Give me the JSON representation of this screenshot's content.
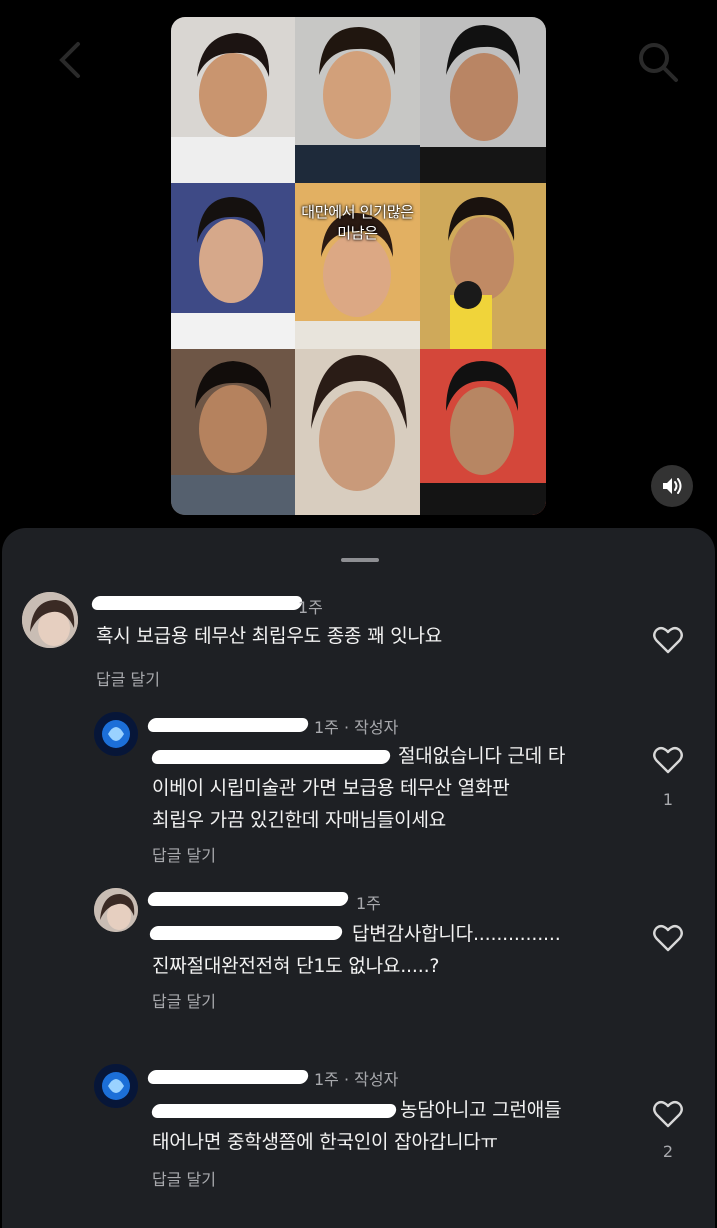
{
  "video": {
    "caption": "대만에서 인기많은 미남은"
  },
  "colors": {
    "sheet_bg": "#1e2024",
    "text": "#f2f2f2",
    "meta": "#a8a9ad",
    "accent": "#6c8bd6"
  },
  "icons": {
    "back": "chevron-left-icon",
    "search": "search-icon",
    "sound": "speaker-icon",
    "like": "heart-icon"
  },
  "comments": [
    {
      "time": "1주",
      "author_tag": "",
      "text": "혹시 보급용 테무산 최립우도 종종 꽤 잇나요",
      "reply_label": "답글 달기",
      "likes": ""
    },
    {
      "time": "1주 · 작성자",
      "text_line1": "절대없습니다  근데 타",
      "text_line2": "이베이 시립미술관 가면 보급용 테무산 열화판",
      "text_line3": "최립우 가끔 있긴한데 자매님들이세요",
      "reply_label": "답글 달기",
      "likes": "1"
    },
    {
      "time": "1주",
      "text_line1": "답변감사합니다...............",
      "text_line2": "진짜절대완전전혀 단1도 없나요.....?",
      "reply_label": "답글 달기",
      "likes": ""
    },
    {
      "time": "1주 · 작성자",
      "text_line1": "농담아니고 그런애들",
      "text_line2": "태어나면 중학생쯤에 한국인이 잡아갑니다ㅠ",
      "reply_label": "답글 달기",
      "likes": "2"
    }
  ]
}
